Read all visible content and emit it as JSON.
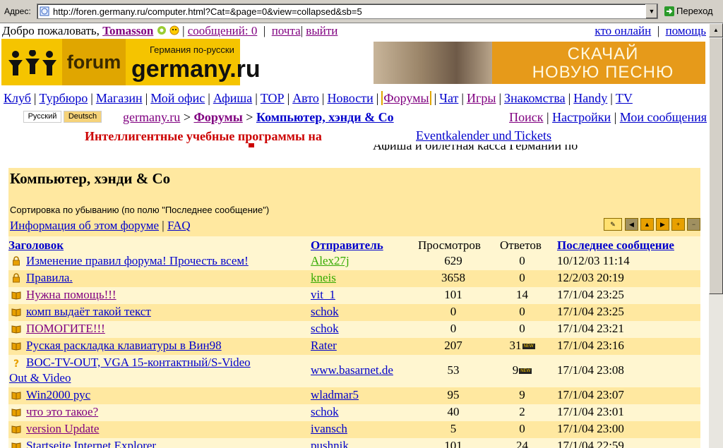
{
  "browser": {
    "address_label": "Адрес:",
    "url": "http://foren.germany.ru/computer.html?Cat=&page=0&view=collapsed&sb=5",
    "go_label": "Переход"
  },
  "header": {
    "welcome": "Добро пожаловать,",
    "username": "Tomasson",
    "messages": "сообщений: 0",
    "mail": "почта",
    "logout": "выйти",
    "who_online": "кто онлайн",
    "help": "помощь"
  },
  "logo": {
    "forum": "forum",
    "site": "germany.ru",
    "tagline": "Германия по-русски"
  },
  "banner": {
    "line1": "СКАЧАЙ",
    "line2": "НОВУЮ ПЕСНЮ"
  },
  "nav": [
    "Клуб",
    "Турбюро",
    "Магазин",
    "Мой офис",
    "Афиша",
    "TOP",
    "Авто",
    "Новости",
    "Форумы",
    "Чат",
    "Игры",
    "Знакомства",
    "Handy",
    "TV"
  ],
  "lang": {
    "ru": "Русский",
    "de": "Deutsch"
  },
  "breadcrumb": {
    "home": "germany.ru",
    "sep": ">",
    "forums": "Форумы",
    "current": "Компьютер, хэнди & Co"
  },
  "right_links": {
    "search": "Поиск",
    "settings": "Настройки",
    "my_messages": "Мои сообщения"
  },
  "ads": {
    "red": "Интеллигентные учебные программы на",
    "event": "Eventkalender und Tickets",
    "event2": "Афиша и билетная касса Германии по"
  },
  "forum": {
    "title": "Компьютер, хэнди & Co",
    "sort_note": "Сортировка по убыванию (по полю \"Последнее сообщение\")",
    "info_link": "Информация об этом форуме",
    "faq": "FAQ",
    "columns": {
      "title": "Заголовок",
      "author": "Отправитель",
      "views": "Просмотров",
      "replies": "Ответов",
      "last": "Последнее сообщение"
    },
    "new_badge": "NEW",
    "rows": [
      {
        "icon": "lock",
        "title": "Изменение правил форума! Прочесть всем!",
        "author": "Alex27j",
        "views": "629",
        "replies": "0",
        "last": "10/12/03 11:14"
      },
      {
        "icon": "lock",
        "title": "Правила.",
        "author": "kneis",
        "views": "3658",
        "replies": "0",
        "last": "12/2/03 20:19"
      },
      {
        "icon": "book",
        "title": "Нужна помощь!!!",
        "author": "vit_1",
        "views": "101",
        "replies": "14",
        "last": "17/1/04 23:25"
      },
      {
        "icon": "book",
        "title": "комп выдаёт такой текст",
        "author": "schok",
        "views": "0",
        "replies": "0",
        "last": "17/1/04 23:25"
      },
      {
        "icon": "book",
        "title": "ПОМОГИТЕ!!!",
        "author": "schok",
        "views": "0",
        "replies": "0",
        "last": "17/1/04 23:21"
      },
      {
        "icon": "book",
        "title": "Руская раскладка клавиатуры в Вин98",
        "author": "Rater",
        "views": "207",
        "replies": "31",
        "last": "17/1/04 23:16"
      },
      {
        "icon": "question",
        "title": "BOC-TV-OUT, VGA 15-контактный/S-Video",
        "title2": "Out & Video",
        "author": "www.basarnet.de",
        "views": "53",
        "replies": "9",
        "last": "17/1/04 23:08"
      },
      {
        "icon": "book",
        "title": " Win2000 рус",
        "author": "wladmar5",
        "views": "95",
        "replies": "9",
        "last": "17/1/04 23:07"
      },
      {
        "icon": "book",
        "title": "что это такое?",
        "author": "schok",
        "views": "40",
        "replies": "2",
        "last": "17/1/04 23:01"
      },
      {
        "icon": "book",
        "title": "version Update",
        "author": "ivansch",
        "views": "5",
        "replies": "0",
        "last": "17/1/04 23:00"
      },
      {
        "icon": "book",
        "title": "Startseite Internet Explorer",
        "author": "pushnik",
        "views": "101",
        "replies": "24",
        "last": "17/1/04 22:59"
      }
    ]
  }
}
